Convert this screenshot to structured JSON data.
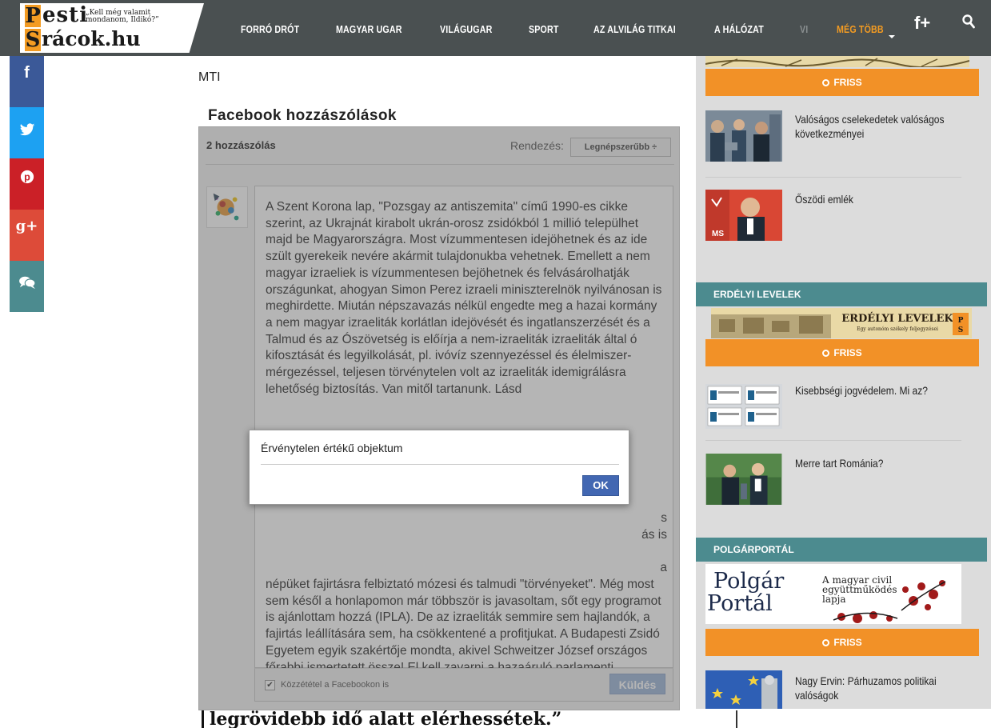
{
  "site": {
    "logo_word1": "esti",
    "logo_word2": "rácok.hu",
    "logo_letter1": "P",
    "logo_letter2": "S",
    "tagline": "„Kell még valamit mondanom, Ildikó?”"
  },
  "nav": {
    "items": [
      "FORRÓ DRÓT",
      "MAGYAR UGAR",
      "VILÁGUGAR",
      "SPORT",
      "AZ ALVILÁG TITKAI",
      "A HÁLÓZAT",
      "VI"
    ],
    "more": "MÉG TÖBB",
    "fplus": "f+"
  },
  "colors": {
    "header": "#4a5051",
    "accent": "#f29127",
    "section": "#4c8b8f",
    "facebook": "#3b5998",
    "twitter": "#1da1f2",
    "pinterest": "#cb2027",
    "googleplus": "#dd4b39",
    "comment": "#4c8b8f"
  },
  "social": {
    "facebook": "f",
    "twitter": "t",
    "pinterest": "p",
    "googleplus": "g+",
    "comments": "💬"
  },
  "article": {
    "source": "MTI",
    "fb_title": "Facebook hozzászólások"
  },
  "comments": {
    "count": "2 hozzászólás",
    "sort_label": "Rendezés:",
    "sort_value": "Legnépszerűbb ÷",
    "text": "A Szent Korona lap, \"Pozsgay az antiszemita\" című 1990-es cikke szerint, az Ukrajnát kirabolt ukrán-orosz zsidókból 1 millió települhet majd be Magyarországra. Most vízummentesen idejöhetnek és az ide szült gyerekeik nevére akármit tulajdonukba vehetnek. Emellett a nem magyar izraeliek is vízummentesen bejöhetnek és felvásárolhatják országunkat, ahogyan Simon Perez izraeli miniszterelnök nyilvánosan is meghirdette. Miután népszavazás nélkül engedte meg a hazai kormány a nem magyar izraeliták korlátlan idejövését és ingatlanszerzését és a Talmud és az Ószövetség is előírja a nem-izraeliták izraeliták által ó kifosztását és legyilkolását, pl. ivóvíz szennyezéssel és élelmiszer- mérgezéssel, teljesen törvénytelen volt az izraeliták idemigrálásra lehetőség biztosítás. Van mitől tartanunk. Lásd",
    "text_hidden_line1": "s",
    "text_hidden_line2": "ás is",
    "text_hidden_line3": "a",
    "text_tail": "népüket fajirtásra felbiztató mózesi és talmudi \"törvényeket\". Még most sem késől a honlapomon már többször is javasoltam, sőt egy programot is ajánlottam hozzá (IPLA). De az izraeliták semmire sem hajlandók, a fajirtás leállítására sem, ha csökkentené a profitjukat. A Budapesti Zsidó Egyetem egyik szakértője mondta, akivel Schweitzer József országos főrabbi ismertetett össze! El kell zavarni a hazaáruló parlamenti képviselőket!",
    "publish_label": "Közzététel a Facebookon is",
    "send": "Küldés"
  },
  "dialog": {
    "message": "Érvénytelen értékű objektum",
    "ok": "OK"
  },
  "bottom_text": "legrövidebb idő alatt elérhessétek.”",
  "sidebar": {
    "friss": "FRISS",
    "items": [
      {
        "title": "Valóságos cselekedetek valóságos következményei"
      },
      {
        "title": "Őszödi emlék"
      },
      {
        "title": "Kisebbségi jogvédelem. Mi az?"
      },
      {
        "title": "Merre tart Románia?"
      },
      {
        "title": "Nagy Ervin: Párhuzamos politikai valóságok"
      }
    ],
    "section_erdelyi": "ERDÉLYI LEVELEK",
    "erdelyi_banner_title": "ERDÉLYI LEVELEK",
    "erdelyi_banner_sub": "Egy autonóm székely feljegyzései",
    "section_polgar": "POLGÁRPORTÁL",
    "polgar_logo1": "Polgár",
    "polgar_logo2": "Portál",
    "polgar_tagline": "A magyar civil együttműködés lapja"
  }
}
